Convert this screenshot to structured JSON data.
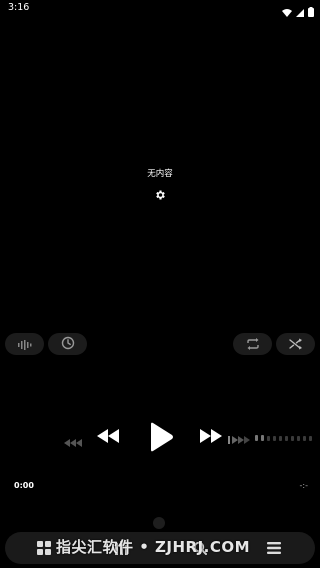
{
  "status_bar": {
    "time": "3:16",
    "icons": [
      "wifi-icon",
      "signal-icon",
      "battery-icon"
    ]
  },
  "main": {
    "empty_text": "无内容",
    "settings_icon": "gear-icon"
  },
  "controls": {
    "left_pills": [
      "waveform-icon",
      "timer-clock-icon"
    ],
    "right_pills": [
      "repeat-icon",
      "shuffle-icon"
    ],
    "transport": [
      "rewind-icon",
      "previous-icon",
      "play-icon",
      "next-icon",
      "forward-icon"
    ]
  },
  "playback": {
    "current_time": "0:00",
    "total_time": "-:-"
  },
  "bottom_nav": {
    "items": [
      "home-icon",
      "library-icon",
      "search-icon",
      "queue-icon"
    ]
  },
  "watermark": {
    "text": "指尖汇软件 • ZJHRJ.COM"
  },
  "colors": {
    "background": "#000000",
    "pill": "#1c1c1c",
    "nav": "#1a1a1a",
    "text": "#ffffff"
  }
}
